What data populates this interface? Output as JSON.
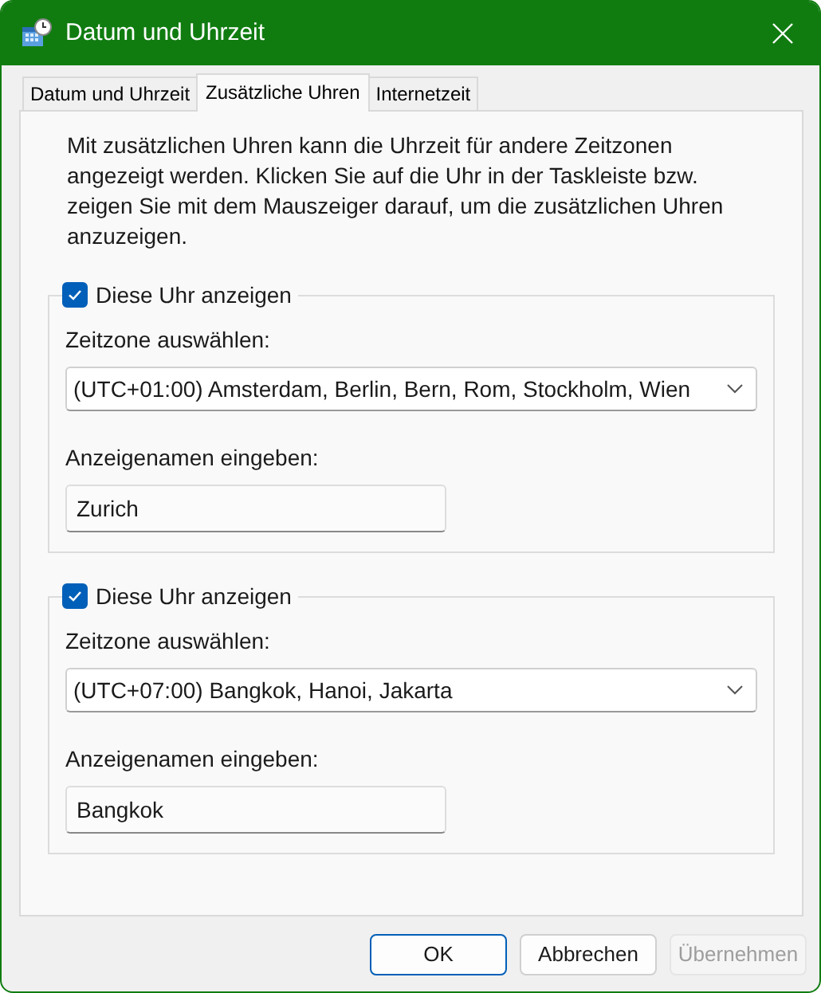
{
  "window": {
    "title": "Datum und Uhrzeit"
  },
  "tabs": [
    {
      "label": "Datum und Uhrzeit",
      "selected": false
    },
    {
      "label": "Zusätzliche Uhren",
      "selected": true
    },
    {
      "label": "Internetzeit",
      "selected": false
    }
  ],
  "description": "Mit zusätzlichen Uhren kann die Uhrzeit für andere Zeitzonen angezeigt werden. Klicken Sie auf die Uhr in der Taskleiste bzw. zeigen Sie mit dem Mauszeiger darauf, um die zusätzlichen Uhren anzuzeigen.",
  "clocks": [
    {
      "label": "Diese Uhr anzeigen",
      "checked": true,
      "timezone_label": "Zeitzone auswählen:",
      "timezone": "(UTC+01:00) Amsterdam, Berlin, Bern, Rom, Stockholm, Wien",
      "name_label": "Anzeigenamen eingeben:",
      "name": "Zurich"
    },
    {
      "label": "Diese Uhr anzeigen",
      "checked": true,
      "timezone_label": "Zeitzone auswählen:",
      "timezone": "(UTC+07:00) Bangkok, Hanoi, Jakarta",
      "name_label": "Anzeigenamen eingeben:",
      "name": "Bangkok"
    }
  ],
  "buttons": [
    {
      "label": "OK",
      "kind": "default",
      "disabled": false
    },
    {
      "label": "Abbrechen",
      "kind": "normal",
      "disabled": false
    },
    {
      "label": "Übernehmen",
      "kind": "normal",
      "disabled": true
    }
  ]
}
